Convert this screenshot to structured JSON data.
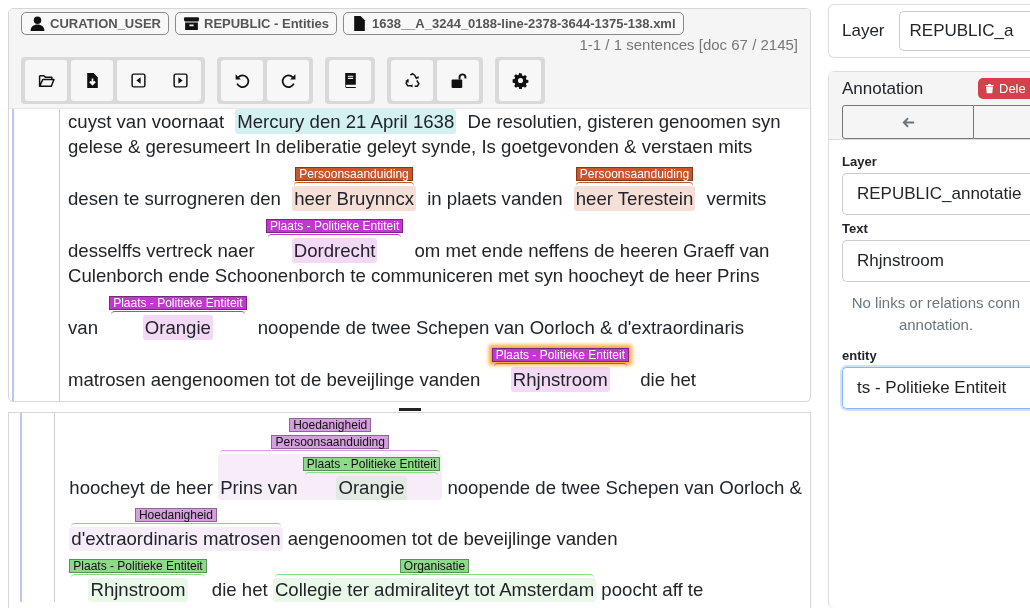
{
  "header": {
    "badges": [
      {
        "kind": "user",
        "label": "CURATION_USER"
      },
      {
        "kind": "project",
        "label": "REPUBLIC - Entities"
      },
      {
        "kind": "document",
        "label": "1638__A_3244_0188-line-2378-3644-1375-138.xml"
      }
    ],
    "position": "1-1 / 1 sentences [doc 67 / 2145]"
  },
  "editor_top": {
    "lines": [
      {
        "segments": [
          {
            "text": "cuyst van voornaat "
          },
          {
            "text": "Mercury den 21 April 1638",
            "color": "#d3f1f1"
          },
          {
            "text": " De resolutien, gisteren genoomen syn"
          }
        ]
      },
      {
        "segments": [
          {
            "text": "gelese & geresumeert In deliberatie geleyt synde, Is goetgevonden & verstaen mits"
          }
        ]
      },
      {
        "segments": [
          {
            "text": "desen te surrogneren den "
          },
          {
            "text": "heer Bruynncx",
            "color": "#c8562d",
            "focused": false,
            "labels": [
              {
                "text": "Persoonsaanduiding"
              }
            ]
          },
          {
            "text": " in plaets vanden "
          },
          {
            "text": "heer Terestein",
            "color": "#c8562d",
            "focused": false,
            "labels": [
              {
                "text": "Persoonsaanduiding"
              }
            ]
          },
          {
            "text": " vermits"
          }
        ]
      },
      {
        "segments": [
          {
            "text": "desselffs vertreck naer "
          },
          {
            "text": "Dordrecht",
            "color": "#c237d0",
            "focused": false,
            "labels": [
              {
                "text": "Plaats - Politieke Entiteit"
              }
            ]
          },
          {
            "text": " om met ende neffens de heeren Graeff van"
          }
        ]
      },
      {
        "segments": [
          {
            "text": "Culenborch ende Schoonenborch te communiceren met syn hoocheyt de heer Prins"
          }
        ]
      },
      {
        "segments": [
          {
            "text": "van "
          },
          {
            "text": "Orangie",
            "color": "#c237d0",
            "focused": false,
            "labels": [
              {
                "text": "Plaats - Politieke Entiteit"
              }
            ]
          },
          {
            "text": " noopende de twee Schepen van Oorloch & d'extraordinaris"
          }
        ]
      },
      {
        "segments": [
          {
            "text": "matrosen aengenoomen tot de beveijlinge vanden "
          },
          {
            "text": "Rhjnstroom",
            "color": "#c237d0",
            "focused": true,
            "labels": [
              {
                "text": "Plaats - Politieke Entiteit"
              }
            ]
          },
          {
            "text": " die het"
          }
        ]
      }
    ]
  },
  "editor_bottom": {
    "lines": [
      {
        "segments": [
          {
            "text": "hoocheyt de heer "
          },
          {
            "color": "#d39fdc",
            "focused": false,
            "labels": [
              {
                "text": "Hoedanigheid"
              },
              {
                "text": "Persoonsaanduiding"
              }
            ],
            "parts": [
              {
                "text": "Prins van "
              },
              {
                "text": "Orangie",
                "color": "#8fd98a",
                "focused": false,
                "labels": [
                  {
                    "text": "Plaats - Politieke Entiteit"
                  }
                ]
              }
            ]
          },
          {
            "text": " noopende de twee Schepen van Oorloch &"
          }
        ]
      },
      {
        "segments": [
          {
            "text": "d'extraordinaris matrosen",
            "color": "#d39fdc",
            "focused": false,
            "labels": [
              {
                "text": "Hoedanigheid"
              }
            ]
          },
          {
            "text": " aengenoomen tot de beveijlinge vanden"
          }
        ]
      },
      {
        "segments": [
          {
            "text": "Rhjnstroom",
            "color": "#8fd98a",
            "focused": false,
            "labels": [
              {
                "text": "Plaats - Politieke Entiteit"
              }
            ]
          },
          {
            "text": " die het "
          },
          {
            "text": "Collegie ter admiraliteyt tot Amsterdam",
            "color": "#8fd98a",
            "focused": false,
            "labels": [
              {
                "text": "Organisatie"
              }
            ]
          },
          {
            "text": " poocht aff te"
          }
        ]
      }
    ]
  },
  "sidebar": {
    "layer_card": {
      "label": "Layer",
      "value": "REPUBLIC_a"
    },
    "annotation_card": {
      "title": "Annotation",
      "delete_label": "Dele",
      "fields": [
        {
          "label": "Layer",
          "value": "REPUBLIC_annotatie"
        },
        {
          "label": "Text",
          "value": "Rhjnstroom"
        }
      ],
      "note_lines": [
        "No links or relations conn",
        "annotation."
      ],
      "feature": {
        "label": "entity",
        "value": "ts - Politieke Entiteit",
        "focused": true
      }
    }
  }
}
